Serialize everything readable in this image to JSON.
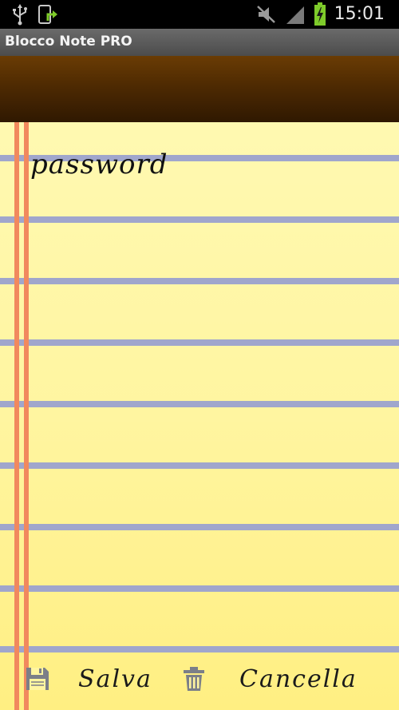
{
  "status_bar": {
    "time": "15:01",
    "left_icons": [
      "usb-icon",
      "download-icon"
    ],
    "right_icons": [
      "mute-icon",
      "signal-icon",
      "battery-charging-icon"
    ],
    "colors": {
      "battery": "#7ecb2a",
      "icons": "#c8c8c8"
    }
  },
  "app": {
    "title": "Blocco Note PRO"
  },
  "note": {
    "text": "password",
    "colors": {
      "paper_top": "#fff9b1",
      "paper_bottom": "#ffef82",
      "rule": "#a0a6cc",
      "margin": "#f1895e",
      "header": "#4e2a02"
    }
  },
  "actions": {
    "save_icon": "floppy-disk-icon",
    "save_label": "Salva",
    "delete_icon": "trash-icon",
    "delete_label": "Cancella"
  }
}
